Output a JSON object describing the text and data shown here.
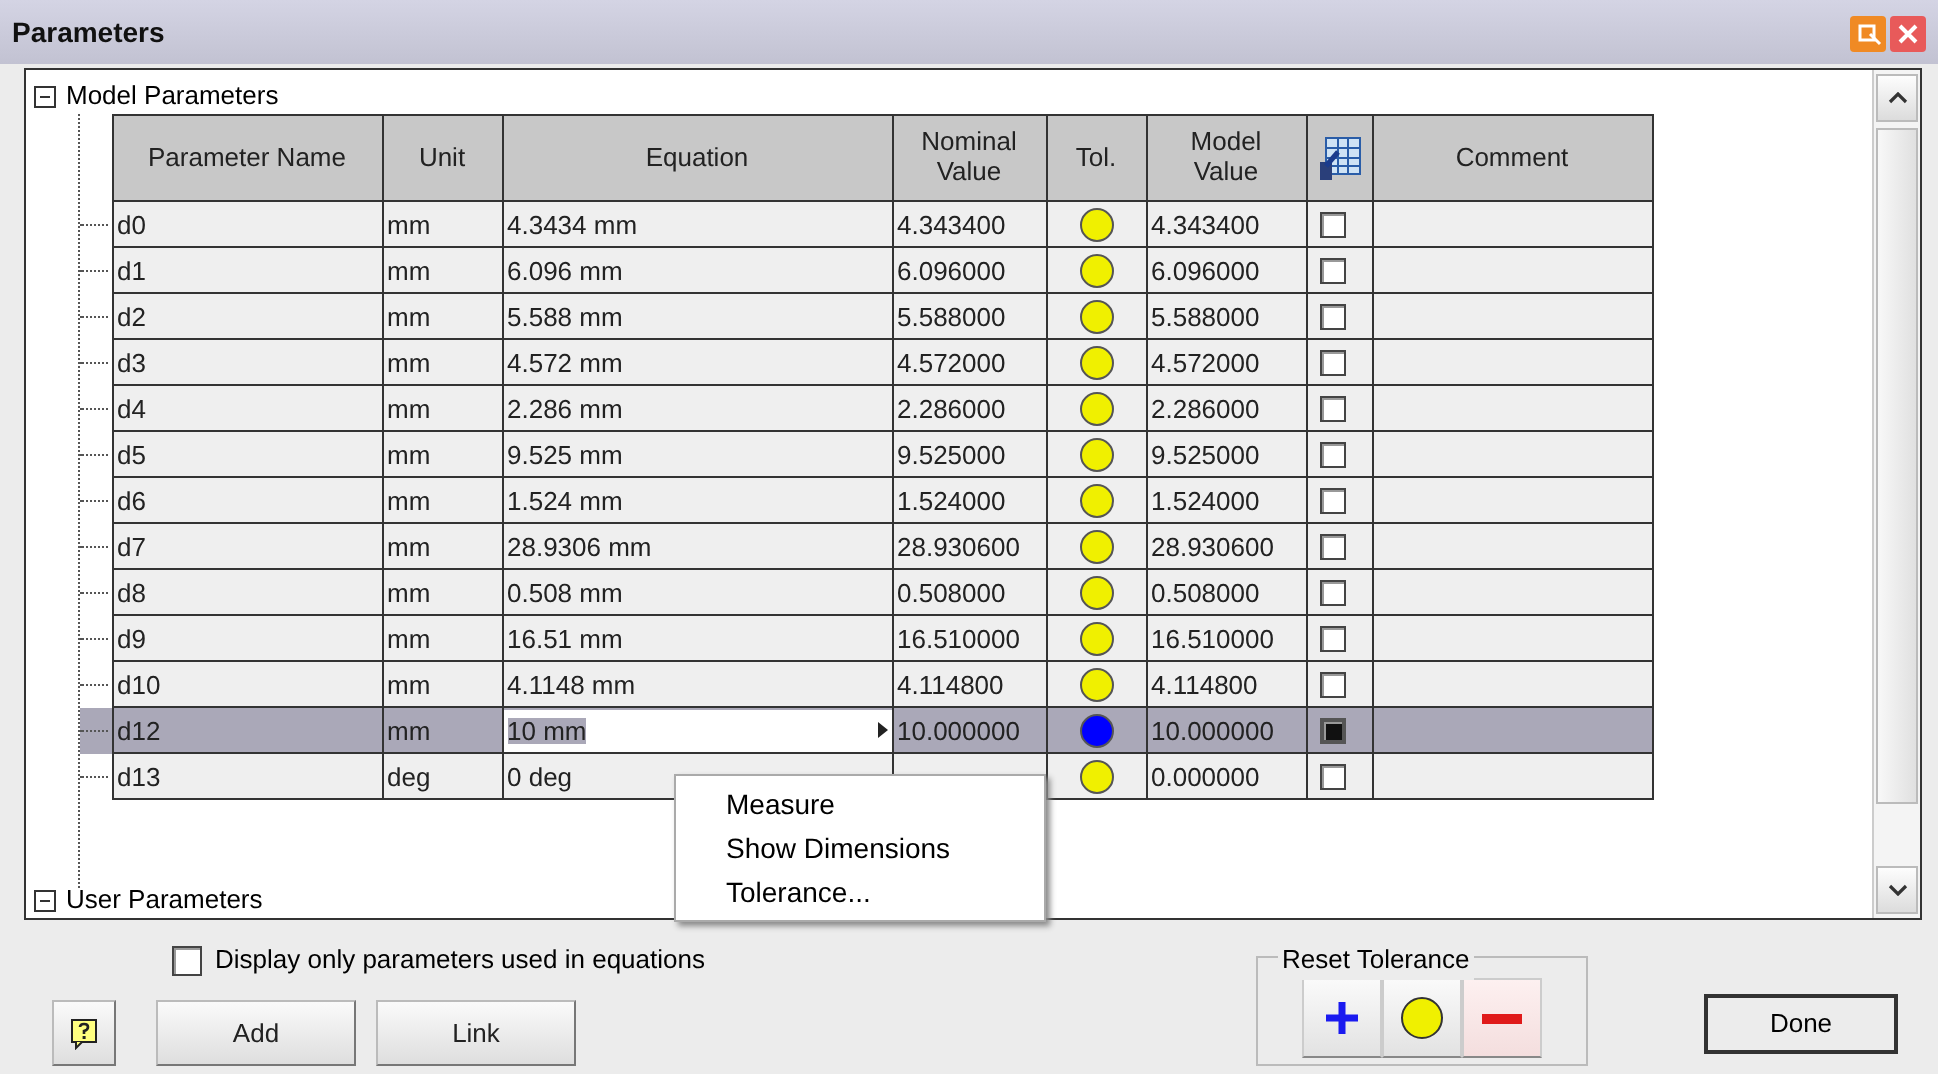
{
  "window": {
    "title": "Parameters"
  },
  "model_parameters": {
    "label": "Model Parameters",
    "expanded": true
  },
  "table": {
    "columns": [
      {
        "kind": "text",
        "label": "Parameter Name"
      },
      {
        "kind": "text",
        "label": "Unit"
      },
      {
        "kind": "text",
        "label": "Equation"
      },
      {
        "kind": "text",
        "label": "Nominal Value"
      },
      {
        "kind": "text",
        "label": "Tol."
      },
      {
        "kind": "text",
        "label": "Model Value"
      },
      {
        "kind": "icon"
      },
      {
        "kind": "text",
        "label": "Comment"
      }
    ],
    "rows": [
      {
        "name": "d0",
        "unit": "mm",
        "equation": "4.3434 mm",
        "nominal": "4.343400",
        "color": "#f0f000",
        "model": "4.343400",
        "checked": false,
        "selected": false,
        "editing": false
      },
      {
        "name": "d1",
        "unit": "mm",
        "equation": "6.096 mm",
        "nominal": "6.096000",
        "color": "#f0f000",
        "model": "6.096000",
        "checked": false,
        "selected": false,
        "editing": false
      },
      {
        "name": "d2",
        "unit": "mm",
        "equation": "5.588 mm",
        "nominal": "5.588000",
        "color": "#f0f000",
        "model": "5.588000",
        "checked": false,
        "selected": false,
        "editing": false
      },
      {
        "name": "d3",
        "unit": "mm",
        "equation": "4.572 mm",
        "nominal": "4.572000",
        "color": "#f0f000",
        "model": "4.572000",
        "checked": false,
        "selected": false,
        "editing": false
      },
      {
        "name": "d4",
        "unit": "mm",
        "equation": "2.286 mm",
        "nominal": "2.286000",
        "color": "#f0f000",
        "model": "2.286000",
        "checked": false,
        "selected": false,
        "editing": false
      },
      {
        "name": "d5",
        "unit": "mm",
        "equation": "9.525 mm",
        "nominal": "9.525000",
        "color": "#f0f000",
        "model": "9.525000",
        "checked": false,
        "selected": false,
        "editing": false
      },
      {
        "name": "d6",
        "unit": "mm",
        "equation": "1.524 mm",
        "nominal": "1.524000",
        "color": "#f0f000",
        "model": "1.524000",
        "checked": false,
        "selected": false,
        "editing": false
      },
      {
        "name": "d7",
        "unit": "mm",
        "equation": "28.9306 mm",
        "nominal": "28.930600",
        "color": "#f0f000",
        "model": "28.930600",
        "checked": false,
        "selected": false,
        "editing": false
      },
      {
        "name": "d8",
        "unit": "mm",
        "equation": "0.508 mm",
        "nominal": "0.508000",
        "color": "#f0f000",
        "model": "0.508000",
        "checked": false,
        "selected": false,
        "editing": false
      },
      {
        "name": "d9",
        "unit": "mm",
        "equation": "16.51 mm",
        "nominal": "16.510000",
        "color": "#f0f000",
        "model": "16.510000",
        "checked": false,
        "selected": false,
        "editing": false
      },
      {
        "name": "d10",
        "unit": "mm",
        "equation": "4.1148 mm",
        "nominal": "4.114800",
        "color": "#f0f000",
        "model": "4.114800",
        "checked": false,
        "selected": false,
        "editing": false
      },
      {
        "name": "d12",
        "unit": "mm",
        "equation": "10 mm",
        "nominal": "10.000000",
        "color": "#0000ff",
        "model": "10.000000",
        "checked": true,
        "selected": true,
        "editing": true
      },
      {
        "name": "d13",
        "unit": "deg",
        "equation": "0 deg",
        "color": "#f0f000",
        "model": "0.000000",
        "checked": false,
        "selected": false,
        "editing": false
      }
    ]
  },
  "user_parameters": {
    "label": "User Parameters",
    "expanded": true
  },
  "context_menu": [
    "Measure",
    "Show Dimensions",
    "Tolerance..."
  ],
  "filter_checkbox": {
    "label": "Display only parameters used in equations",
    "checked": false
  },
  "buttons": [
    {
      "kind": "help"
    },
    {
      "kind": "text",
      "label": "Add"
    },
    {
      "kind": "text",
      "label": "Link"
    }
  ],
  "reset_tolerance": {
    "label": "Reset Tolerance",
    "buttons": [
      {
        "kind": "plus"
      },
      {
        "kind": "nominal"
      },
      {
        "kind": "minus"
      }
    ]
  },
  "done_button": "Done"
}
